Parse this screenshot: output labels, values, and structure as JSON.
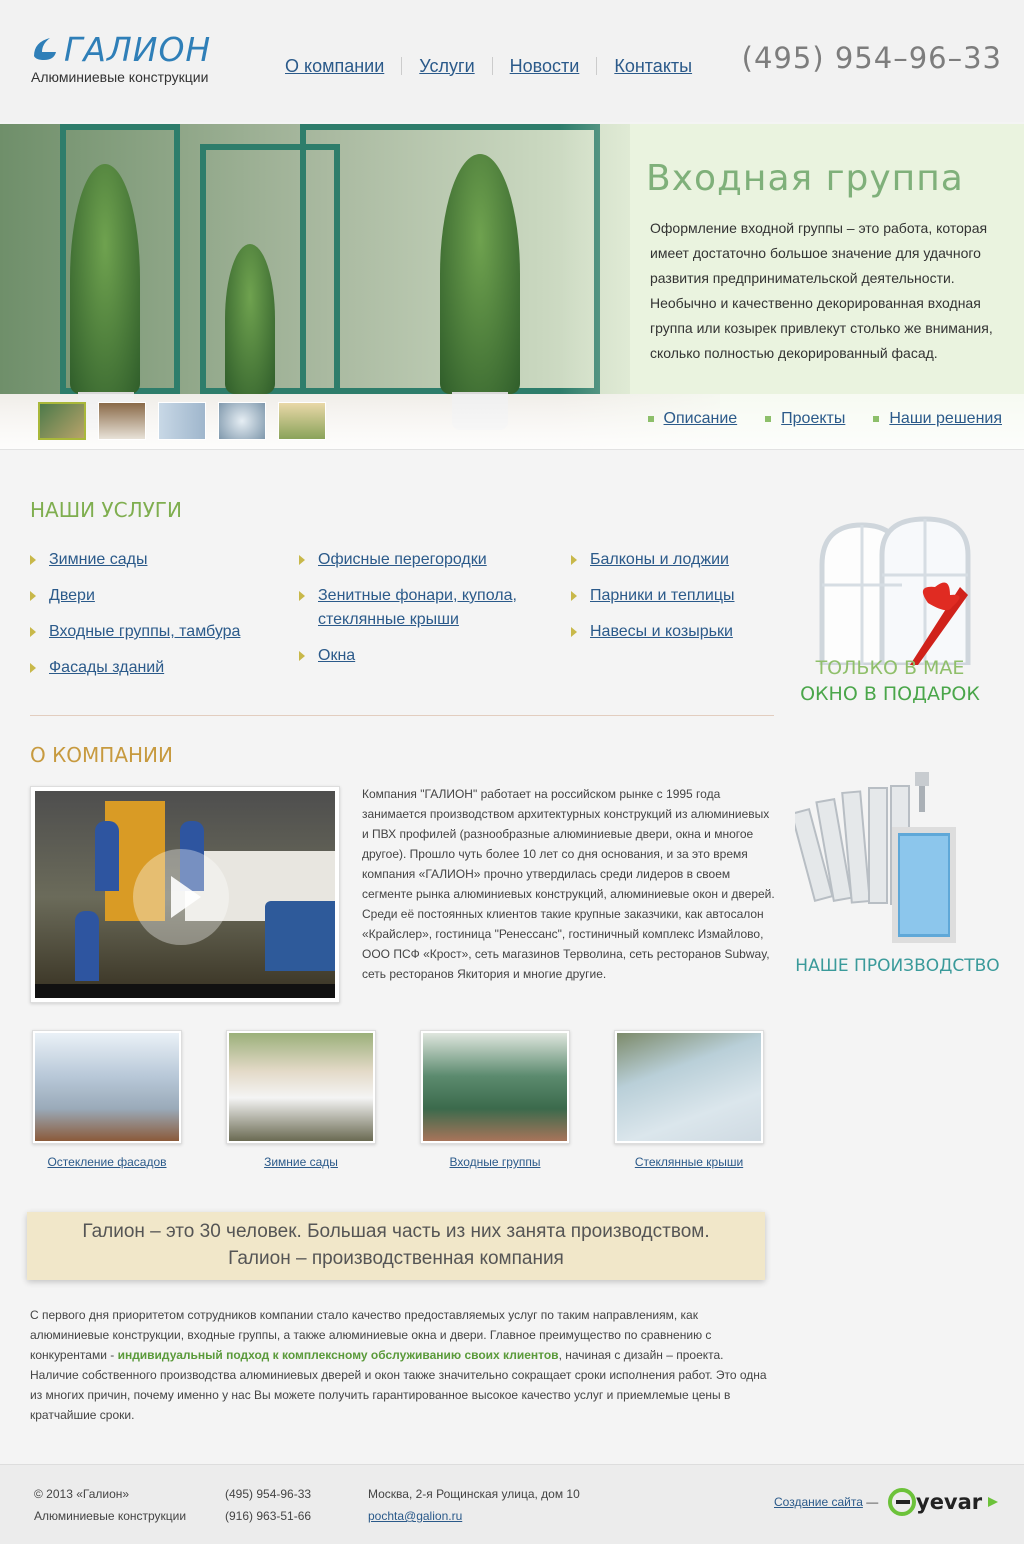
{
  "header": {
    "logo_text": "ГАЛИОН",
    "logo_sub": "Алюминиевые конструкции",
    "nav": [
      "О компании",
      "Услуги",
      "Новости",
      "Контакты"
    ],
    "phone": "(495) 954–96–33"
  },
  "banner": {
    "title": "Входная группа",
    "description": "Оформление входной группы – это работа, которая имеет достаточно большое значение для удачного развития предпринимательской деятельности. Необычно и качественно декорированная входная группа или козырек привлекут столько же внимания, сколько полностью декорированный фасад.",
    "tabs": [
      "Описание",
      "Проекты",
      "Наши решения"
    ]
  },
  "services": {
    "title": "НАШИ УСЛУГИ",
    "col1": [
      "Зимние сады",
      "Двери",
      "Входные группы, тамбура",
      "Фасады зданий"
    ],
    "col2": [
      "Офисные перегородки",
      "Зенитные фонари, купола, стеклянные крыши",
      "Окна"
    ],
    "col3": [
      "Балконы и лоджии",
      "Парники и теплицы",
      "Навесы и козырьки"
    ]
  },
  "promo": {
    "line1": "ТОЛЬКО В МАЕ",
    "line2": "ОКНО В ПОДАРОК"
  },
  "about": {
    "title": "О КОМПАНИИ",
    "text": "Компания \"ГАЛИОН\" работает на российском рынке с 1995 года занимается производством архитектурных конструкций из алюминиевых и ПВХ профилей (разнообразные алюминиевые двери, окна и многое другое). Прошло чуть более 10 лет со дня основания, и за это время компания «ГАЛИОН» прочно утвердилась среди лидеров в своем сегменте рынка алюминиевых конструкций, алюминиевые окон и дверей. Среди её постоянных клиентов такие крупные заказчики, как автосалон «Крайслер», гостиница \"Ренессанс\", гостиничный комплекс Измайлово, ООО ПСФ «Крост», сеть магазинов Терволина, сеть ресторанов Subway, сеть ресторанов Якитория и многие другие."
  },
  "production": {
    "label": "НАШЕ ПРОИЗВОДСТВО"
  },
  "gallery": [
    "Остекление фасадов",
    "Зимние сады",
    "Входные группы",
    "Стеклянные крыши"
  ],
  "quote": {
    "line1": "Галион – это 30 человек. Большая часть из них занята производством.",
    "line2": "Галион – производственная компания"
  },
  "body": {
    "before": "С первого дня приоритетом сотрудников компании стало качество предоставляемых услуг по таким направлениям, как алюминиевые конструкции, входные группы, а также алюминиевые окна и двери. Главное преимущество по сравнению с конкурентами - ",
    "highlight": "индивидуальный подход к комплексному обслуживанию своих клиентов",
    "after": ", начиная с дизайн – проекта. Наличие собственного производства алюминиевых дверей и окон также значительно сокращает сроки исполнения работ. Это одна из многих причин, почему именно у нас Вы можете получить гарантированное высокое качество услуг и приемлемые цены в кратчайшие сроки."
  },
  "footer": {
    "copyright": "© 2013  «Галион»",
    "company": "Алюминиевые конструкции",
    "phone1": "(495) 954-96-33",
    "phone2": "(916) 963-51-66",
    "address": "Москва, 2-я Рощинская улица, дом 10",
    "email": "pochta@galion.ru",
    "made_label": "Создание сайта",
    "made_dash": "—",
    "studio": "yevar"
  },
  "colors": {
    "accent_green": "#7fae4f",
    "link_blue": "#2b5a8a",
    "about_orange": "#c79a3f"
  }
}
